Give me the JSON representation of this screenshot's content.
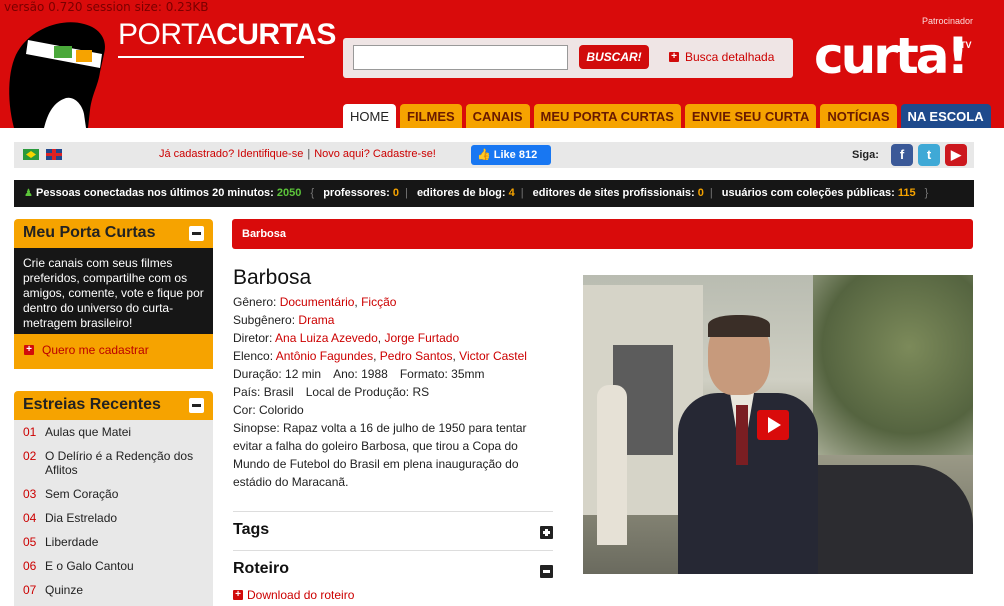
{
  "debug": "versão 0.720 session size: 0.23KB",
  "brand": {
    "light": "PORTA",
    "bold": "CURTAS"
  },
  "search": {
    "value": "",
    "placeholder": "",
    "button": "BUSCAR!",
    "advanced": "Busca detalhada"
  },
  "sponsor": {
    "label": "Patrocinador",
    "logo": "curta!",
    "tv": "TV"
  },
  "nav": [
    {
      "label": "HOME",
      "active": true
    },
    {
      "label": "FILMES"
    },
    {
      "label": "CANAIS"
    },
    {
      "label": "MEU PORTA CURTAS"
    },
    {
      "label": "ENVIE SEU CURTA"
    },
    {
      "label": "NOTÍCIAS"
    },
    {
      "label": "NA ESCOLA"
    }
  ],
  "account": {
    "login": "Já cadastrado? Identifique-se",
    "signup": "Novo aqui? Cadastre-se!",
    "sep": "|"
  },
  "facebook": {
    "label": "Like",
    "count": "812"
  },
  "follow": {
    "label": "Siga:",
    "icons": [
      "facebook-icon",
      "twitter-icon",
      "youtube-icon"
    ]
  },
  "online": {
    "label": "Pessoas conectadas nos últimos 20 minutos:",
    "total": "2050",
    "groups": [
      {
        "label": "professores:",
        "value": "0"
      },
      {
        "label": "editores de blog:",
        "value": "4"
      },
      {
        "label": "editores de sites profissionais:",
        "value": "0"
      },
      {
        "label": "usuários com coleções públicas:",
        "value": "115"
      }
    ]
  },
  "my_porta_curtas": {
    "title": "Meu Porta Curtas",
    "text": "Crie canais com seus filmes preferidos, compartilhe com os amigos, comente, vote e fique por dentro do universo do curta-metragem brasileiro!",
    "link": "Quero me cadastrar"
  },
  "releases": {
    "title": "Estreias Recentes",
    "items": [
      {
        "n": "01",
        "title": "Aulas que Matei"
      },
      {
        "n": "02",
        "title": "O Delírio é a Redenção dos Aflitos"
      },
      {
        "n": "03",
        "title": "Sem Coração"
      },
      {
        "n": "04",
        "title": "Dia Estrelado"
      },
      {
        "n": "05",
        "title": "Liberdade"
      },
      {
        "n": "06",
        "title": "E o Galo Cantou"
      },
      {
        "n": "07",
        "title": "Quinze"
      }
    ]
  },
  "breadcrumb": "Barbosa",
  "film": {
    "title": "Barbosa",
    "genre_label": "Gênero:",
    "genres": [
      "Documentário",
      "Ficção"
    ],
    "subgenre_label": "Subgênero:",
    "subgenre": "Drama",
    "director_label": "Diretor:",
    "directors": [
      "Ana Luiza Azevedo",
      "Jorge Furtado"
    ],
    "cast_label": "Elenco:",
    "cast": [
      "Antônio Fagundes",
      "Pedro Santos",
      "Victor Castel"
    ],
    "duration_label": "Duração:",
    "duration": "12 min",
    "year_label": "Ano:",
    "year": "1988",
    "format_label": "Formato:",
    "format": "35mm",
    "country_label": "País:",
    "country": "Brasil",
    "place_label": "Local de Produção:",
    "place": "RS",
    "color_label": "Cor:",
    "color": "Colorido",
    "synopsis_label": "Sinopse:",
    "synopsis": "Rapaz volta a 16 de julho de 1950 para tentar evitar a falha do goleiro Barbosa, que tirou a Copa do Mundo de Futebol do Brasil em plena inauguração do estádio do Maracanã."
  },
  "sections": {
    "tags": "Tags",
    "script": "Roteiro",
    "download": "Download do roteiro"
  }
}
